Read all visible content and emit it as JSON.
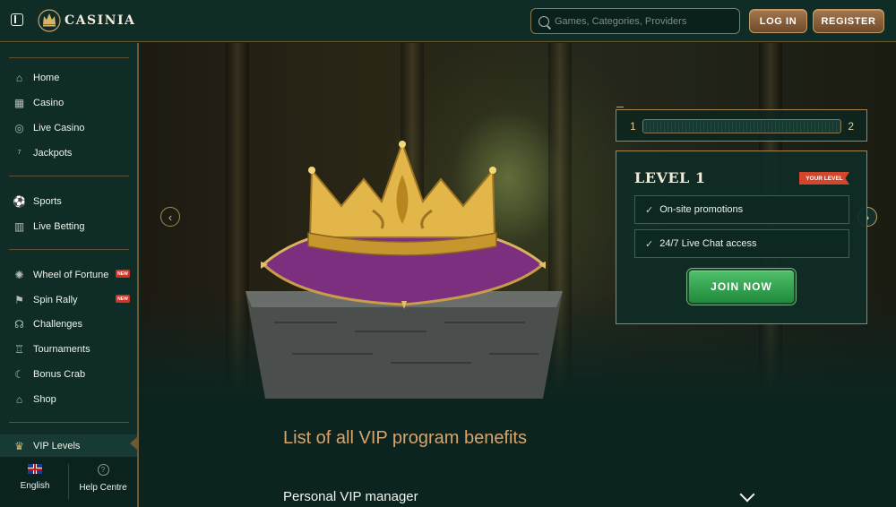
{
  "header": {
    "brand": "CASINIA",
    "search_placeholder": "Games, Categories, Providers",
    "login_label": "LOG IN",
    "register_label": "REGISTER"
  },
  "sidebar": {
    "items": [
      {
        "label": "Home",
        "icon": "home-icon"
      },
      {
        "label": "Casino",
        "icon": "casino-icon"
      },
      {
        "label": "Live Casino",
        "icon": "live-casino-icon"
      },
      {
        "label": "Jackpots",
        "icon": "jackpot-icon"
      },
      {
        "label": "Sports",
        "icon": "sports-icon"
      },
      {
        "label": "Live Betting",
        "icon": "live-betting-icon"
      },
      {
        "label": "Wheel of Fortune",
        "icon": "wheel-icon",
        "badge": "NEW"
      },
      {
        "label": "Spin Rally",
        "icon": "flag-icon",
        "badge": "NEW"
      },
      {
        "label": "Challenges",
        "icon": "challenge-icon"
      },
      {
        "label": "Tournaments",
        "icon": "trophy-icon"
      },
      {
        "label": "Bonus Crab",
        "icon": "crab-icon"
      },
      {
        "label": "Shop",
        "icon": "shop-icon"
      },
      {
        "label": "VIP Levels",
        "icon": "crown-icon"
      }
    ],
    "language": "English",
    "help": "Help Centre"
  },
  "hero": {
    "progress": {
      "from": "1",
      "to": "2",
      "fill": 0.0
    },
    "level_title": "LEVEL 1",
    "your_level_badge": "YOUR LEVEL",
    "benefits": [
      "On-site promotions",
      "24/7 Live Chat access"
    ],
    "join_label": "JOIN NOW"
  },
  "content": {
    "section_title": "List of all VIP program benefits",
    "accordion_first": "Personal VIP manager"
  },
  "colors": {
    "background": "#0c2420",
    "accent_gold": "#d9a46a",
    "join_green": "#2ea34c",
    "new_badge": "#d33324"
  }
}
